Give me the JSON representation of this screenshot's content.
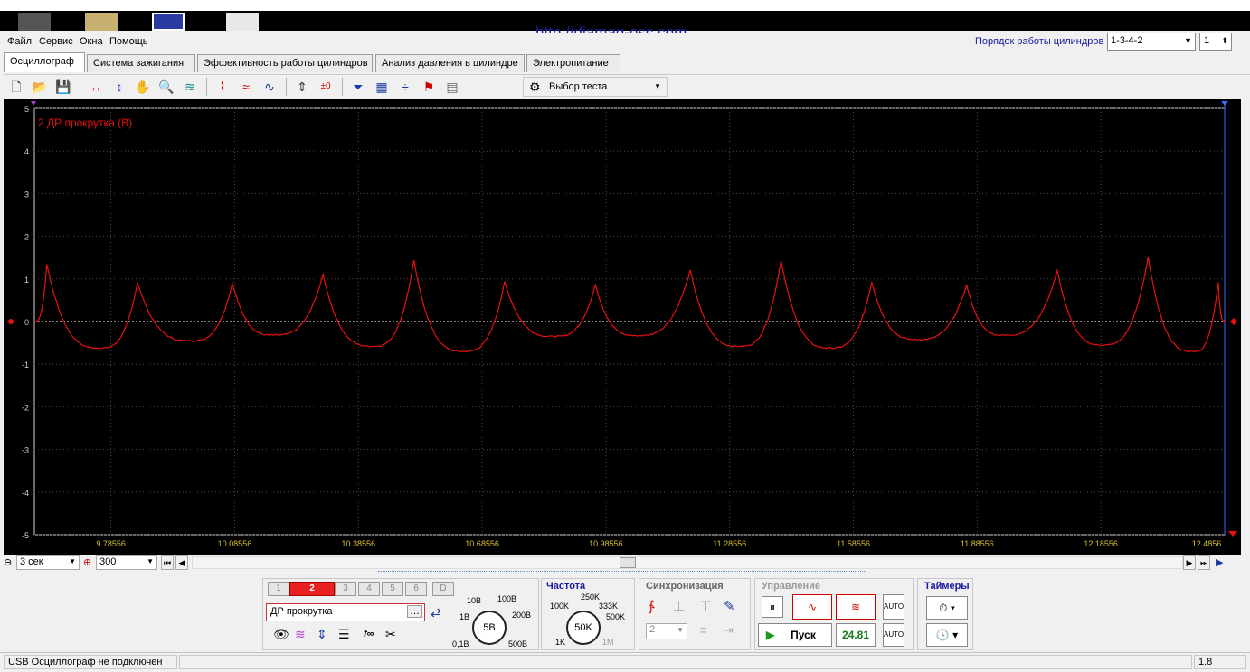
{
  "app": {
    "url_banner": "http://diamag-osc.com"
  },
  "menu": {
    "items": [
      "Файл",
      "Сервис",
      "Окна",
      "Помощь"
    ]
  },
  "cylinders": {
    "label": "Порядок работы цилиндров",
    "order": "1-3-4-2",
    "count": "1"
  },
  "tabs": [
    "Осциллограф",
    "Система зажигания",
    "Эффективность работы цилиндров",
    "Анализ давления в цилиндре",
    "Электропитание"
  ],
  "toolbar": {
    "test_select": "Выбор теста"
  },
  "chart_data": {
    "type": "line",
    "title": "2 ДР прокрутка (В)",
    "series_color": "#e81010",
    "ylim": [
      -5,
      5
    ],
    "yticks": [
      "5",
      "4",
      "3",
      "2",
      "1",
      "0",
      "-1",
      "-2",
      "-3",
      "-4",
      "-5"
    ],
    "xlim": [
      9.6,
      12.4856
    ],
    "xticks": [
      "9.78556",
      "10.08556",
      "10.38556",
      "10.68556",
      "10.98556",
      "11.28556",
      "11.58556",
      "11.88556",
      "12.18556",
      "12.4856"
    ],
    "grid": true,
    "peaks": [
      {
        "x": 9.63,
        "y": 1.35
      },
      {
        "x": 9.85,
        "y": 0.92
      },
      {
        "x": 10.08,
        "y": 0.9
      },
      {
        "x": 10.3,
        "y": 1.1
      },
      {
        "x": 10.52,
        "y": 1.43
      },
      {
        "x": 10.74,
        "y": 0.93
      },
      {
        "x": 10.96,
        "y": 0.86
      },
      {
        "x": 11.19,
        "y": 1.2
      },
      {
        "x": 11.41,
        "y": 1.44
      },
      {
        "x": 11.63,
        "y": 0.93
      },
      {
        "x": 11.86,
        "y": 0.86
      },
      {
        "x": 12.08,
        "y": 1.2
      },
      {
        "x": 12.3,
        "y": 1.52
      },
      {
        "x": 12.47,
        "y": 0.92
      }
    ],
    "troughs": [
      {
        "x": 9.76,
        "y": -0.62
      },
      {
        "x": 9.98,
        "y": -0.45
      },
      {
        "x": 10.18,
        "y": -0.32
      },
      {
        "x": 10.42,
        "y": -0.58
      },
      {
        "x": 10.64,
        "y": -0.7
      },
      {
        "x": 10.86,
        "y": -0.35
      },
      {
        "x": 11.06,
        "y": -0.33
      },
      {
        "x": 11.31,
        "y": -0.58
      },
      {
        "x": 11.53,
        "y": -0.62
      },
      {
        "x": 11.74,
        "y": -0.42
      },
      {
        "x": 11.95,
        "y": -0.32
      },
      {
        "x": 12.19,
        "y": -0.55
      },
      {
        "x": 12.41,
        "y": -0.7
      }
    ],
    "zero_line": 0
  },
  "scroll": {
    "time_combo": "3 сек",
    "points_combo": "300"
  },
  "channels": [
    "1",
    "2",
    "3",
    "4",
    "5",
    "6",
    "D"
  ],
  "active_channel": "2",
  "probe": "ДР прокрутка",
  "volt_knob": {
    "value": "5В",
    "labels": [
      "10В",
      "100В",
      "200В",
      "500В",
      "0,1В",
      "1В"
    ]
  },
  "freq": {
    "title": "Частота",
    "value": "50K",
    "labels": [
      "250K",
      "100K",
      "333K",
      "500K",
      "1M",
      "1K"
    ]
  },
  "sync": {
    "title": "Синхронизация",
    "channel": "2"
  },
  "control": {
    "title": "Управление",
    "start": "Пуск",
    "rate": "24.81"
  },
  "timers": {
    "title": "Таймеры"
  },
  "status": {
    "left": "USB Осциллограф не подключен",
    "right": "1.8"
  }
}
